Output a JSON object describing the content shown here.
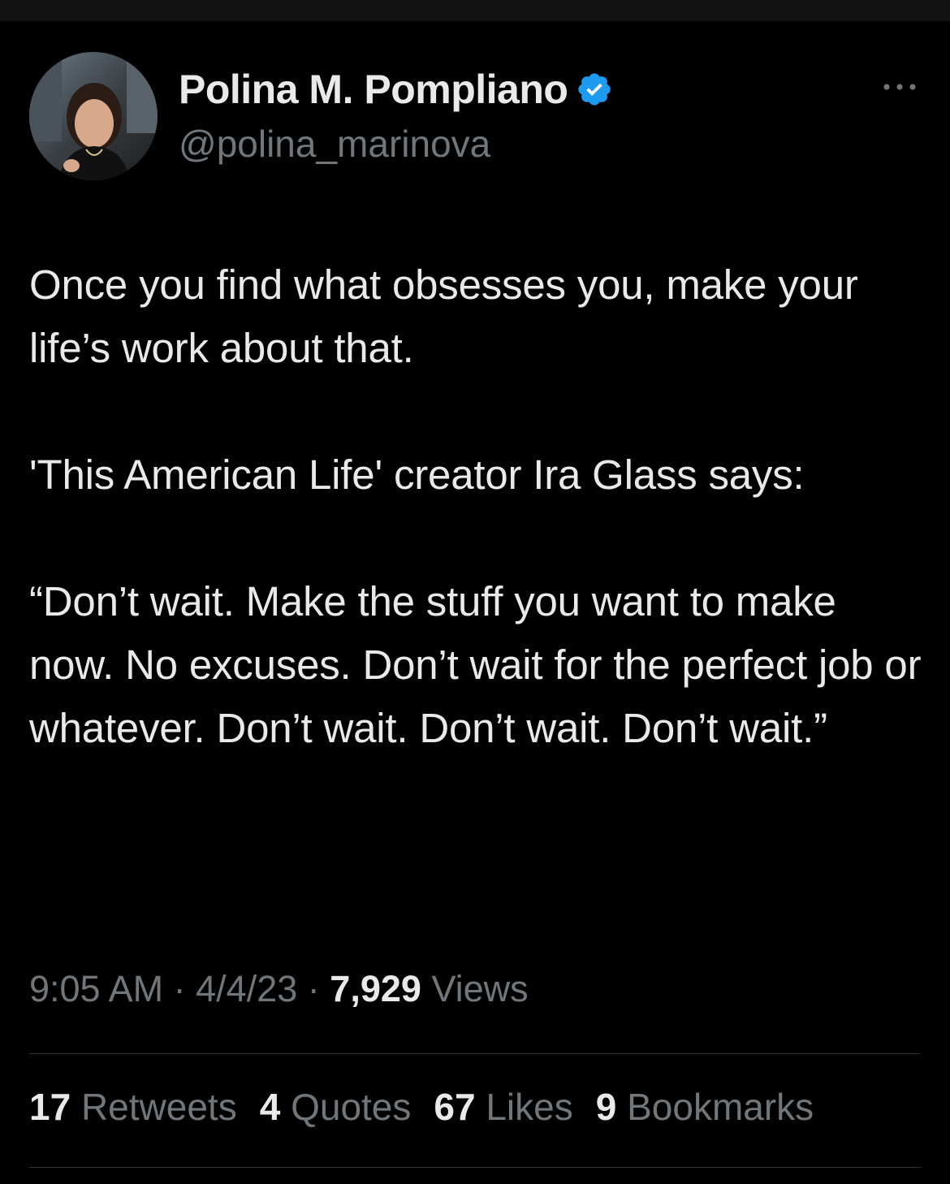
{
  "colors": {
    "background": "#000000",
    "text_primary": "#e7e9ea",
    "text_secondary": "#71767b",
    "verified": "#1d9bf0",
    "divider": "#2f3336"
  },
  "author": {
    "display_name": "Polina M. Pompliano",
    "handle": "@polina_marinova",
    "verified_icon": "verified-badge-icon",
    "avatar_alt": "profile photo"
  },
  "tweet": {
    "text": "Once you find what obsesses you, make your life’s work about that.\n\n'This American Life' creator Ira Glass says:\n\n“Don’t wait. Make the stuff you want to make now. No excuses. Don’t wait for the perfect job or whatever. Don’t wait. Don’t wait. Don’t wait.”"
  },
  "meta": {
    "time": "9:05 AM",
    "separator": "·",
    "date": "4/4/23",
    "views_count": "7,929",
    "views_label": "Views"
  },
  "stats": {
    "retweets_count": "17",
    "retweets_label": "Retweets",
    "quotes_count": "4",
    "quotes_label": "Quotes",
    "likes_count": "67",
    "likes_label": "Likes",
    "bookmarks_count": "9",
    "bookmarks_label": "Bookmarks"
  }
}
